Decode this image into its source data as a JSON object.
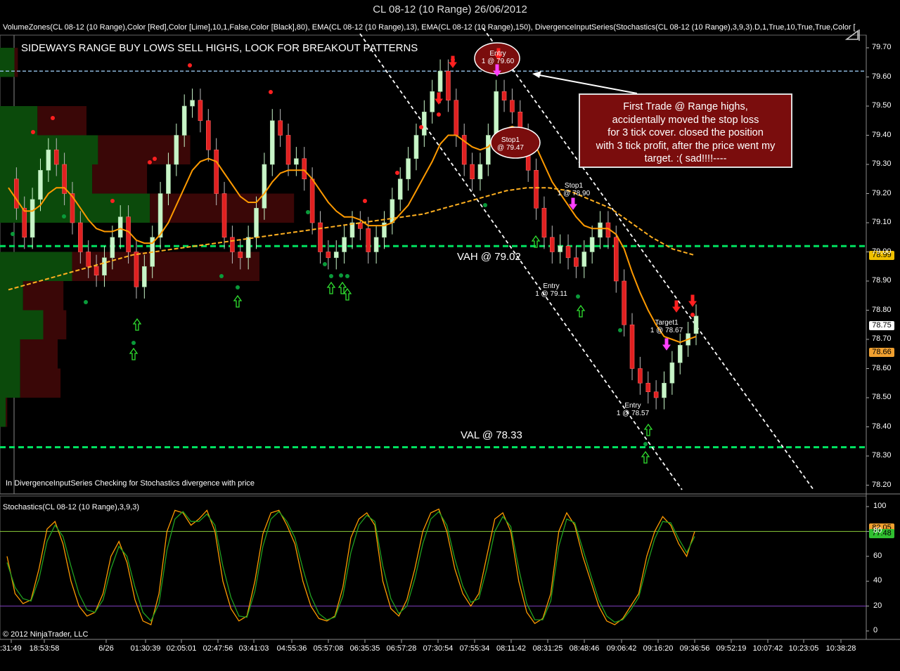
{
  "window": {
    "title": "CL 08-12 (10 Range)  26/06/2012"
  },
  "indicators_line": "VolumeZones(CL 08-12 (10 Range),Color [Red],Color [Lime],10,1,False,Color [Black],80), EMA(CL 08-12 (10 Range),13), EMA(CL 08-12 (10 Range),150), DivergenceInputSeries(Stochastics(CL 08-12 (10 Range),3,9,3).D,1,True,10,True,True,Color [",
  "headline": "SIDEWAYS RANGE BUY LOWS SELL HIGHS, LOOK FOR BREAKOUT PATTERNS",
  "note_lines": [
    "First Trade @ Range highs,",
    "accidentally moved the stop loss",
    "for 3 tick cover. closed the position",
    "with 3 tick profit, after the price went my",
    "target. :( sad!!!!----"
  ],
  "vah_label": "VAH @ 79.02",
  "val_label": "VAL @ 78.33",
  "divergence_note": "In DivergenceInputSeries Checking for Stochastics  divergence with price",
  "stoch_title": "Stochastics(CL 08-12 (10 Range),3,9,3)",
  "copyright": "© 2012 NinjaTrader, LLC",
  "trade_labels": [
    {
      "id": "entry-top",
      "line1": "Entry",
      "line2": "1 @ 79.60"
    },
    {
      "id": "stop-top",
      "line1": "Stop1",
      "line2": "@ 79.47"
    },
    {
      "id": "stop1",
      "line1": "Stop1",
      "line2": "1 @ 78.90"
    },
    {
      "id": "entry-mid",
      "line1": "Entry",
      "line2": "1 @ 79.11"
    },
    {
      "id": "target1",
      "line1": "Target1",
      "line2": "1 @ 78.67"
    },
    {
      "id": "entry-low",
      "line1": "Entry",
      "line2": "1 @ 78.57"
    }
  ],
  "price_boxes": [
    {
      "value": "78.99",
      "bg": "#f0c000",
      "fg": "#000"
    },
    {
      "value": "78.75",
      "bg": "#ffffff",
      "fg": "#000"
    },
    {
      "value": "78.66",
      "bg": "#f0a030",
      "fg": "#000"
    },
    {
      "value": "82.05",
      "bg": "#f0a030",
      "fg": "#000"
    },
    {
      "value": "77.48",
      "bg": "#30c030",
      "fg": "#000"
    }
  ],
  "colors": {
    "up_candle": "#c8f5c8",
    "down_candle": "#e02020",
    "ema13": "#ff9a00",
    "ema150": "#ffb020",
    "value_area": "#00e060",
    "vol_buy": "#0b4a0b",
    "vol_sell": "#3a0707"
  },
  "chart_data": [
    {
      "type": "candlestick",
      "title": "CL 08-12 (10 Range)  26/06/2012",
      "y_ticks": [
        "79.70",
        "79.60",
        "79.50",
        "79.40",
        "79.30",
        "79.20",
        "79.10",
        "79.00",
        "78.90",
        "78.80",
        "78.70",
        "78.60",
        "78.50",
        "78.40",
        "78.30",
        "78.20"
      ],
      "x_ticks": [
        ":31:49",
        "18:53:58",
        "6/26",
        "01:30:39",
        "02:05:01",
        "02:47:56",
        "03:41:03",
        "04:55:36",
        "05:57:08",
        "06:35:35",
        "06:57:28",
        "07:30:54",
        "07:55:34",
        "08:11:42",
        "08:31:25",
        "08:48:46",
        "09:06:42",
        "09:16:20",
        "09:36:56",
        "09:52:19",
        "10:07:42",
        "10:23:05",
        "10:38:28"
      ],
      "ylim": [
        78.18,
        79.72
      ],
      "horizontal_levels": {
        "range_high": 79.62,
        "vah": 79.02,
        "val": 78.33
      },
      "close_path": [
        79.25,
        79.15,
        79.05,
        79.18,
        79.28,
        79.35,
        79.3,
        79.2,
        79.1,
        79.0,
        78.95,
        78.92,
        78.98,
        79.05,
        79.12,
        79.0,
        78.88,
        78.95,
        79.05,
        79.2,
        79.3,
        79.4,
        79.5,
        79.52,
        79.45,
        79.35,
        79.2,
        79.05,
        79.0,
        78.98,
        79.05,
        79.15,
        79.3,
        79.45,
        79.4,
        79.3,
        79.32,
        79.25,
        79.1,
        79.0,
        78.98,
        79.0,
        79.05,
        79.1,
        79.08,
        79.0,
        79.05,
        79.1,
        79.18,
        79.25,
        79.32,
        79.4,
        79.48,
        79.55,
        79.62,
        79.52,
        79.4,
        79.3,
        79.25,
        79.3,
        79.4,
        79.55,
        79.52,
        79.48,
        79.4,
        79.28,
        79.15,
        79.05,
        79.0,
        79.02,
        78.98,
        78.95,
        79.0,
        79.05,
        79.1,
        79.05,
        78.9,
        78.75,
        78.6,
        78.55,
        78.52,
        78.5,
        78.55,
        78.62,
        78.68,
        78.72,
        78.78
      ],
      "ema13_path": [
        79.22,
        79.18,
        79.14,
        79.14,
        79.16,
        79.2,
        79.22,
        79.22,
        79.19,
        79.15,
        79.11,
        79.08,
        79.07,
        79.07,
        79.08,
        79.07,
        79.04,
        79.03,
        79.03,
        79.06,
        79.1,
        79.16,
        79.22,
        79.28,
        79.31,
        79.32,
        79.31,
        79.27,
        79.23,
        79.19,
        79.17,
        79.17,
        79.2,
        79.24,
        79.27,
        79.28,
        79.28,
        79.28,
        79.25,
        79.21,
        79.17,
        79.14,
        79.12,
        79.12,
        79.11,
        79.09,
        79.09,
        79.09,
        79.1,
        79.13,
        79.16,
        79.21,
        79.26,
        79.31,
        79.37,
        79.4,
        79.4,
        79.38,
        79.36,
        79.35,
        79.36,
        79.39,
        79.42,
        79.43,
        79.42,
        79.4,
        79.36,
        79.3,
        79.24,
        79.2,
        79.16,
        79.12,
        79.09,
        79.08,
        79.08,
        79.08,
        79.06,
        79.01,
        78.93,
        78.86,
        78.8,
        78.75,
        78.71,
        78.7,
        78.69,
        78.7,
        78.71
      ],
      "ema150_path": [
        78.87,
        78.89,
        78.91,
        78.93,
        78.95,
        78.97,
        78.99,
        79.0,
        79.01,
        79.02,
        79.03,
        79.04,
        79.05,
        79.06,
        79.07,
        79.08,
        79.09,
        79.1,
        79.11,
        79.12,
        79.13,
        79.15,
        79.17,
        79.19,
        79.21,
        79.22,
        79.22,
        79.21,
        79.18,
        79.15,
        79.1,
        79.05,
        79.01,
        78.99
      ],
      "volume_zones": [
        {
          "price_low": 79.6,
          "price_high": 79.7,
          "buy": 0.5,
          "sell": 0.12
        },
        {
          "price_low": 79.4,
          "price_high": 79.5,
          "buy": 1.3,
          "sell": 1.7
        },
        {
          "price_low": 79.3,
          "price_high": 79.4,
          "buy": 3.4,
          "sell": 3.2
        },
        {
          "price_low": 79.2,
          "price_high": 79.3,
          "buy": 3.2,
          "sell": 1.9
        },
        {
          "price_low": 79.1,
          "price_high": 79.2,
          "buy": 5.2,
          "sell": 5.0
        },
        {
          "price_low": 78.9,
          "price_high": 79.0,
          "buy": 2.5,
          "sell": 6.5
        },
        {
          "price_low": 78.8,
          "price_high": 78.9,
          "buy": 0.8,
          "sell": 1.4
        },
        {
          "price_low": 78.7,
          "price_high": 78.8,
          "buy": 1.5,
          "sell": 0.8
        },
        {
          "price_low": 78.6,
          "price_high": 78.7,
          "buy": 0.7,
          "sell": 1.3
        },
        {
          "price_low": 78.5,
          "price_high": 78.6,
          "buy": 0.7,
          "sell": 1.4
        },
        {
          "price_low": 78.4,
          "price_high": 78.5,
          "buy": 0.2,
          "sell": 0.05
        }
      ]
    },
    {
      "type": "line",
      "title": "Stochastics(CL 08-12 (10 Range),3,9,3)",
      "y_ticks": [
        "100",
        "80",
        "60",
        "40",
        "20",
        "0"
      ],
      "ylim": [
        -5,
        105
      ],
      "levels": [
        80,
        20
      ],
      "series": [
        {
          "values": [
            60,
            30,
            22,
            25,
            50,
            82,
            88,
            70,
            40,
            20,
            12,
            15,
            30,
            60,
            72,
            55,
            25,
            8,
            5,
            30,
            80,
            97,
            95,
            85,
            90,
            97,
            80,
            40,
            18,
            8,
            12,
            40,
            78,
            95,
            97,
            85,
            70,
            40,
            20,
            10,
            8,
            12,
            35,
            75,
            90,
            95,
            85,
            40,
            18,
            12,
            25,
            50,
            80,
            95,
            98,
            80,
            50,
            30,
            20,
            30,
            60,
            90,
            95,
            80,
            40,
            15,
            6,
            10,
            30,
            80,
            95,
            85,
            60,
            40,
            20,
            8,
            5,
            10,
            20,
            30,
            60,
            80,
            92,
            85,
            70,
            60,
            80
          ]
        },
        {
          "values": [
            55,
            35,
            26,
            24,
            42,
            72,
            85,
            76,
            52,
            30,
            17,
            15,
            25,
            50,
            68,
            60,
            35,
            15,
            8,
            22,
            65,
            90,
            96,
            88,
            88,
            94,
            85,
            52,
            27,
            12,
            11,
            32,
            68,
            90,
            96,
            88,
            75,
            50,
            28,
            14,
            9,
            11,
            28,
            63,
            85,
            93,
            88,
            52,
            26,
            14,
            20,
            42,
            70,
            90,
            96,
            85,
            58,
            36,
            23,
            26,
            50,
            80,
            92,
            84,
            50,
            22,
            9,
            9,
            24,
            68,
            90,
            87,
            66,
            45,
            25,
            12,
            7,
            9,
            17,
            27,
            52,
            74,
            88,
            87,
            74,
            63,
            76
          ]
        }
      ]
    }
  ]
}
